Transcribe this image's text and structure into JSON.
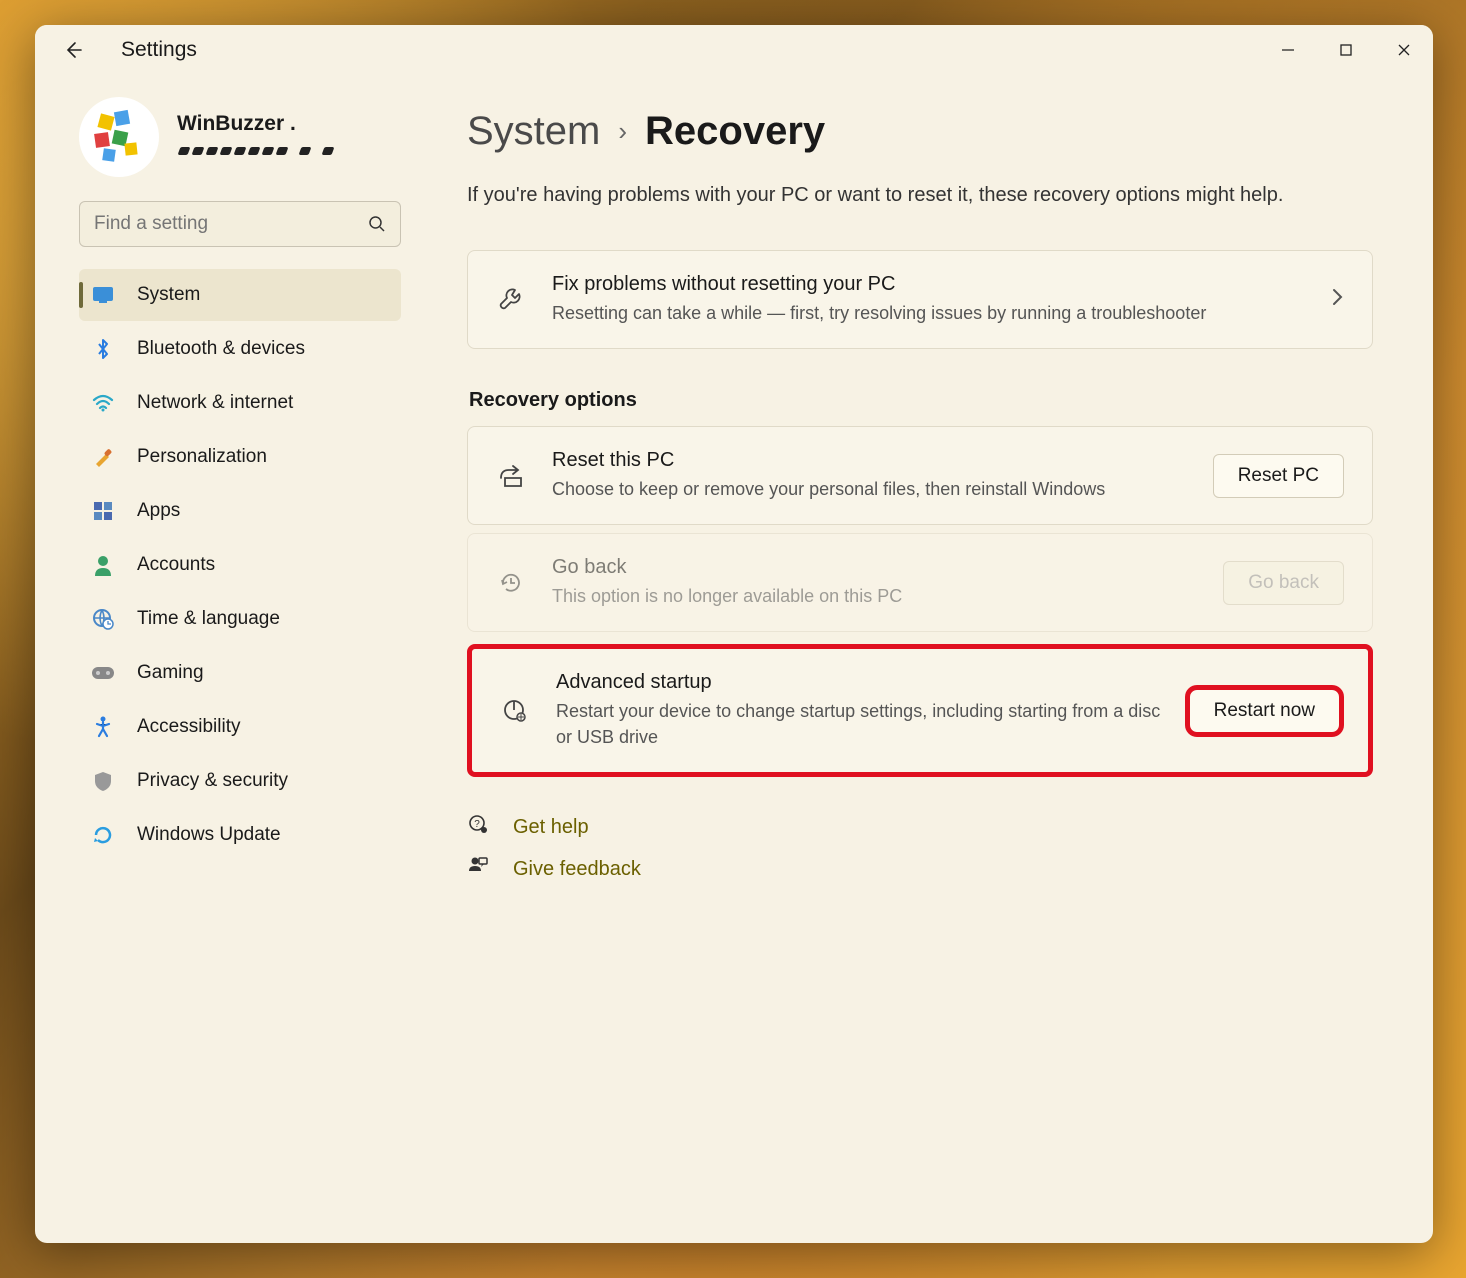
{
  "window": {
    "title": "Settings"
  },
  "profile": {
    "name": "WinBuzzer ."
  },
  "search": {
    "placeholder": "Find a setting"
  },
  "nav": {
    "items": [
      {
        "label": "System",
        "icon": "system"
      },
      {
        "label": "Bluetooth & devices",
        "icon": "bluetooth"
      },
      {
        "label": "Network & internet",
        "icon": "wifi"
      },
      {
        "label": "Personalization",
        "icon": "brush"
      },
      {
        "label": "Apps",
        "icon": "apps"
      },
      {
        "label": "Accounts",
        "icon": "person"
      },
      {
        "label": "Time & language",
        "icon": "globe-clock"
      },
      {
        "label": "Gaming",
        "icon": "gamepad"
      },
      {
        "label": "Accessibility",
        "icon": "accessibility"
      },
      {
        "label": "Privacy & security",
        "icon": "shield"
      },
      {
        "label": "Windows Update",
        "icon": "update"
      }
    ],
    "active_index": 0
  },
  "breadcrumb": {
    "parent": "System",
    "current": "Recovery"
  },
  "page_description": "If you're having problems with your PC or want to reset it, these recovery options might help.",
  "cards": {
    "troubleshoot": {
      "title": "Fix problems without resetting your PC",
      "subtitle": "Resetting can take a while — first, try resolving issues by running a troubleshooter"
    }
  },
  "section_heading": "Recovery options",
  "recovery": {
    "reset": {
      "title": "Reset this PC",
      "subtitle": "Choose to keep or remove your personal files, then reinstall Windows",
      "button": "Reset PC"
    },
    "goback": {
      "title": "Go back",
      "subtitle": "This option is no longer available on this PC",
      "button": "Go back"
    },
    "advanced": {
      "title": "Advanced startup",
      "subtitle": "Restart your device to change startup settings, including starting from a disc or USB drive",
      "button": "Restart now"
    }
  },
  "footer": {
    "help": "Get help",
    "feedback": "Give feedback"
  }
}
